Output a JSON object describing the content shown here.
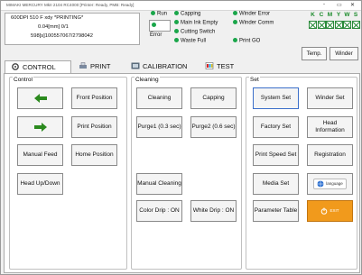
{
  "window": {
    "title": "MIMAKI MERCURY MkII 2104 RC4000 [Printer: Ready, PMB: Ready]",
    "min": "-",
    "max": "▭",
    "close": "✕"
  },
  "info": {
    "line1": "600DPI 510 F xdy  *PRINTING*",
    "line2": "0.04[mm]    0/1",
    "line3": "598[s]100557067/2798042"
  },
  "status": {
    "run": "Run",
    "capping": "Capping",
    "winder_error": "Winder Error",
    "error": "Error",
    "main_ink_empty": "Main Ink Empty",
    "winder_comm": "Winder Comm",
    "cutting_switch": "Cutting Switch",
    "waste_full": "Waste Full",
    "print_go": "Print GO"
  },
  "ink_status": {
    "letters": [
      "K",
      "C",
      "M",
      "Y",
      "W",
      "S"
    ],
    "color": "#1a8a2a"
  },
  "top_buttons": {
    "temp": "Temp.",
    "winder": "Winder"
  },
  "tabs": [
    {
      "label": "CONTROL",
      "icon": "gear-icon"
    },
    {
      "label": "PRINT",
      "icon": "printer-icon"
    },
    {
      "label": "CALIBRATION",
      "icon": "calibration-icon"
    },
    {
      "label": "TEST",
      "icon": "test-icon"
    }
  ],
  "control": {
    "group_label": "Control",
    "front_position": "Front Position",
    "print_position": "Print Position",
    "manual_feed": "Manual Feed",
    "home_position": "Home Position",
    "head_updown": "Head Up/Down"
  },
  "cleaning": {
    "group_label": "Cleaning",
    "cleaning": "Cleaning",
    "capping": "Capping",
    "purge1": "Purge1 (0.3 sec)",
    "purge2": "Purge2 (0.6 sec)",
    "manual_cleaning": "Manual Cleaning",
    "color_drip": "Color Drip : ON",
    "white_drip": "White Drip : ON"
  },
  "set": {
    "group_label": "Set",
    "system_set": "System Set",
    "winder_set": "Winder Set",
    "factory_set": "Factory Set",
    "head_information": "Head Information",
    "print_speed_set": "Print Speed Set",
    "registration": "Registration",
    "media_set": "Media Set",
    "language_tag": "language",
    "parameter_table": "Parameter Table",
    "exit_label": "EXIT"
  },
  "colors": {
    "accent_blue": "#3b6fc9",
    "status_green": "#1aa64a",
    "arrow_green": "#2b8a1e",
    "exit_orange": "#f19a1c"
  }
}
